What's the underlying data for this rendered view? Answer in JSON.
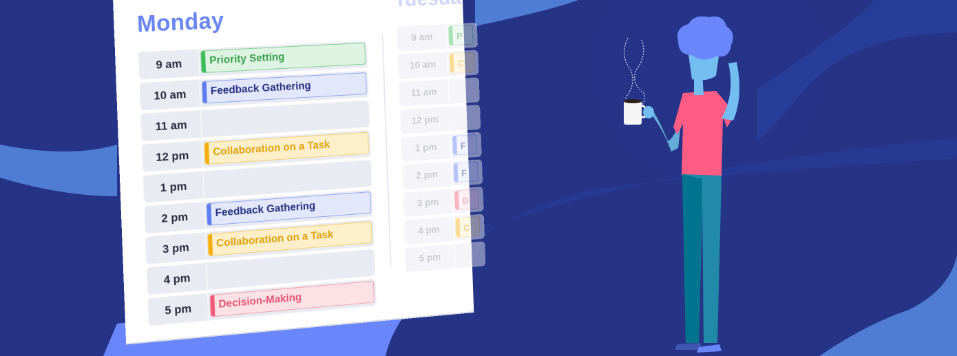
{
  "colors": {
    "background": "#263487",
    "accent_light": "#4f7dd4",
    "accent_bright": "#6a86fb",
    "day_title": "#6b86f0",
    "priority": {
      "bg": "#dff3e2",
      "border": "#7fd08e",
      "bar": "#3ebc5a",
      "text": "#3aa14f"
    },
    "feedback": {
      "bg": "#e2e7fb",
      "border": "#8fa4f2",
      "bar": "#5c7cf0",
      "text": "#27307e"
    },
    "collaboration": {
      "bg": "#fdefc9",
      "border": "#f4cf6c",
      "bar": "#f4ae10",
      "text": "#e0a210"
    },
    "decision": {
      "bg": "#fde1e5",
      "border": "#f4a0b0",
      "bar": "#ef5b78",
      "text": "#e45576"
    }
  },
  "monday": {
    "title": "Monday",
    "rows": [
      {
        "time": "9 am",
        "event": "Priority Setting",
        "type": "priority"
      },
      {
        "time": "10 am",
        "event": "Feedback Gathering",
        "type": "feedback"
      },
      {
        "time": "11 am",
        "event": "",
        "type": ""
      },
      {
        "time": "12 pm",
        "event": "Collaboration on a Task",
        "type": "collaboration"
      },
      {
        "time": "1 pm",
        "event": "",
        "type": ""
      },
      {
        "time": "2 pm",
        "event": "Feedback Gathering",
        "type": "feedback"
      },
      {
        "time": "3 pm",
        "event": "Collaboration on a Task",
        "type": "collaboration"
      },
      {
        "time": "4 pm",
        "event": "",
        "type": ""
      },
      {
        "time": "5 pm",
        "event": "Decision-Making",
        "type": "decision"
      }
    ]
  },
  "tuesday": {
    "title": "Tuesda",
    "rows": [
      {
        "time": "9 am",
        "event": "P",
        "type": "priority"
      },
      {
        "time": "10 am",
        "event": "C",
        "type": "collaboration"
      },
      {
        "time": "11 am",
        "event": "",
        "type": ""
      },
      {
        "time": "12 pm",
        "event": "",
        "type": ""
      },
      {
        "time": "1 pm",
        "event": "F",
        "type": "feedback"
      },
      {
        "time": "2 pm",
        "event": "F",
        "type": "feedback"
      },
      {
        "time": "3 pm",
        "event": "D",
        "type": "decision"
      },
      {
        "time": "4 pm",
        "event": "C",
        "type": "collaboration"
      },
      {
        "time": "5 pm",
        "event": "",
        "type": ""
      }
    ]
  }
}
